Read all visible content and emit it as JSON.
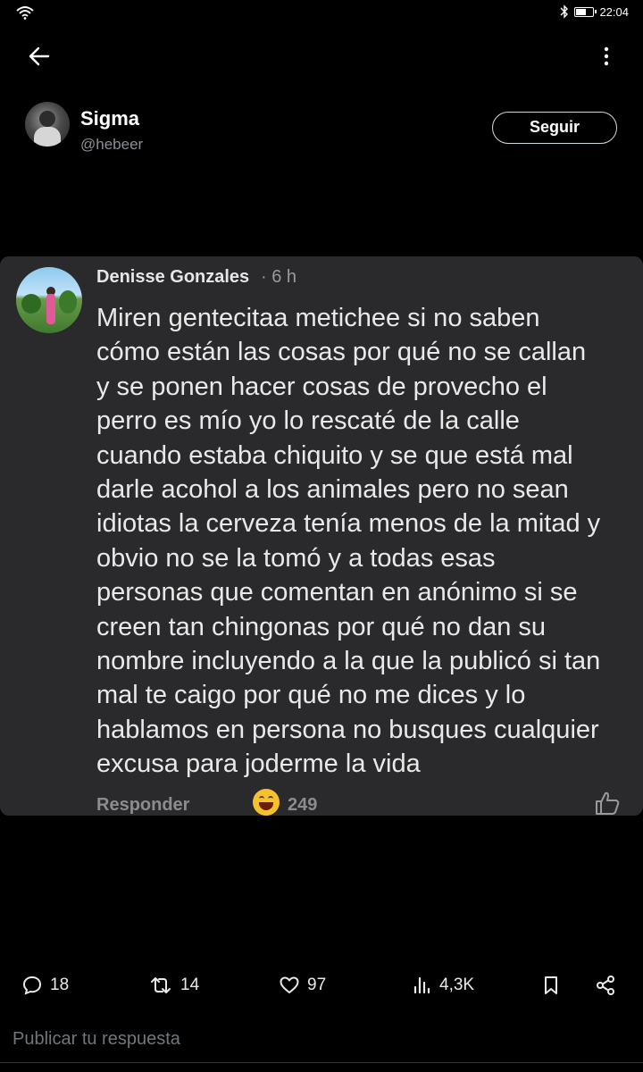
{
  "status_bar": {
    "time": "22:04",
    "battery_level": 0.6
  },
  "author": {
    "name": "Sigma",
    "handle": "@hebeer"
  },
  "follow": {
    "label": "Seguir"
  },
  "embedded_comment": {
    "commenter_name": "Denisse Gonzales",
    "time": "· 6 h",
    "lines": [
      "Miren gentecitaa metichee si no saben",
      "cómo están las cosas por qué no se callan",
      "y se ponen hacer cosas de provecho el",
      "perro es mío yo lo rescaté de la calle",
      "cuando estaba chiquito y se que está mal",
      "darle acohol a los animales pero no sean",
      "idiotas la cerveza tenía menos de la mitad y",
      "obvio no se la tomó y a todas esas",
      "personas que comentan en anónimo si se",
      "creen tan chingonas por qué no dan su",
      "nombre incluyendo a la que la publicó si tan",
      "mal te caigo por qué no me dices y lo",
      "hablamos en persona no busques cualquier",
      "excusa para joderme la vida"
    ],
    "reply_label": "Responder",
    "reaction_count": "249"
  },
  "actions": {
    "replies": "18",
    "reposts": "14",
    "likes": "97",
    "views": "4,3K"
  },
  "reply_placeholder": "Publicar tu respuesta",
  "icons": {
    "back": "arrow-left-icon",
    "more": "more-vertical-icon",
    "reply": "chat-bubble-icon",
    "repost": "repost-icon",
    "like": "heart-icon",
    "views": "bar-chart-icon",
    "bookmark": "bookmark-icon",
    "share": "share-icon"
  }
}
